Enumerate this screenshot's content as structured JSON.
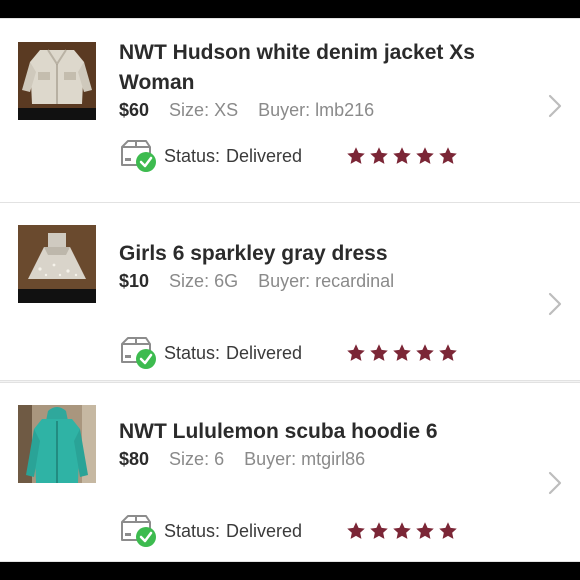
{
  "listings": [
    {
      "title": "NWT Hudson white denim jacket Xs Woman",
      "price": "$60",
      "size_text": "Size: XS",
      "buyer_text": "Buyer: lmb216",
      "status_label": "Status:",
      "status_value": "Delivered",
      "rating": 5,
      "image_icon": "white-denim-jacket-photo"
    },
    {
      "title": "Girls 6 sparkley gray dress",
      "price": "$10",
      "size_text": "Size: 6G",
      "buyer_text": "Buyer: recardinal",
      "status_label": "Status:",
      "status_value": "Delivered",
      "rating": 5,
      "image_icon": "gray-dress-photo"
    },
    {
      "title": "NWT Lululemon scuba hoodie 6",
      "price": "$80",
      "size_text": "Size: 6",
      "buyer_text": "Buyer: mtgirl86",
      "status_label": "Status:",
      "status_value": "Delivered",
      "rating": 5,
      "image_icon": "teal-hoodie-photo"
    }
  ],
  "colors": {
    "star": "#7b2636",
    "check_badge": "#3dbb4f",
    "title_text": "#2b2b2b",
    "meta_text": "#8a8a8a",
    "chevron": "#bdbdbd",
    "background": "#f3f3f3"
  },
  "icons": {
    "status": "box-delivered-icon",
    "rating": "star-icon",
    "navigate": "chevron-right-icon"
  }
}
